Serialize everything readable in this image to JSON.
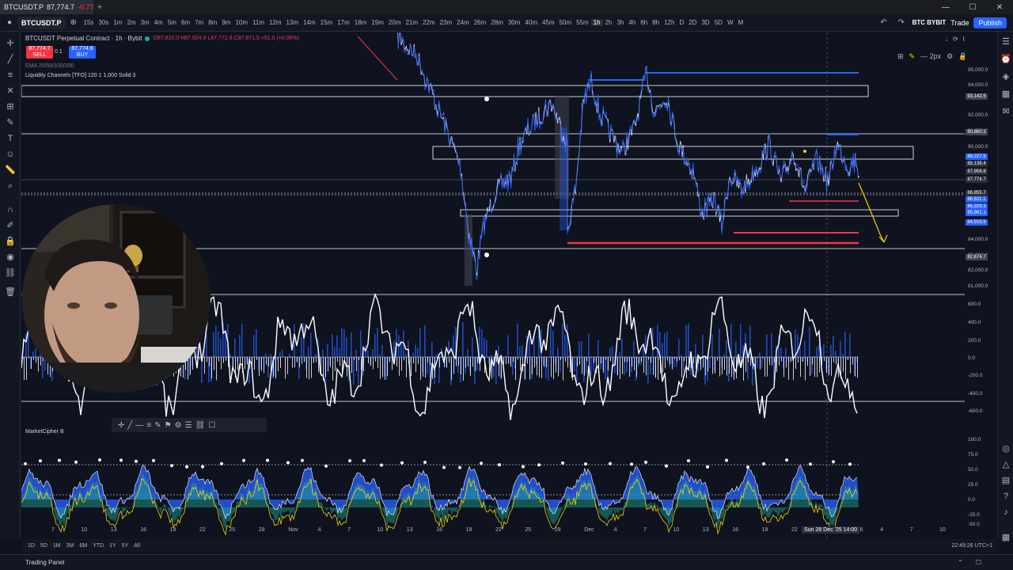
{
  "browser": {
    "tab_symbol": "BTCUSDT.P",
    "tab_price": "87,774.7",
    "tab_change": "-0.77%",
    "new_tab": "+",
    "controls": [
      "—",
      "☐",
      "✕"
    ]
  },
  "toolbar": {
    "symbol": "BTCUSDT.P",
    "timeframes": [
      "15s",
      "30s",
      "1m",
      "2m",
      "3m",
      "4m",
      "5m",
      "6m",
      "7m",
      "8m",
      "9m",
      "10m",
      "11m",
      "12m",
      "13m",
      "14m",
      "15m",
      "17m",
      "18m",
      "19m",
      "20m",
      "21m",
      "22m",
      "23m",
      "24m",
      "26m",
      "28m",
      "30m",
      "40m",
      "45m",
      "50m",
      "55m",
      "1h",
      "2h",
      "3h",
      "4h",
      "6h",
      "8h",
      "12h",
      "D",
      "2D",
      "3D",
      "5D",
      "W",
      "M"
    ],
    "active_timeframe": "1h",
    "exchange": "BTC BYBIT",
    "trade_label": "Trade",
    "publish_label": "Publish"
  },
  "legend": {
    "title": "BTCUSDT Perpetual Contract · 1h · Bybit",
    "ohlc": "O87,820.0 H87,924.9 L87,772.8 C87,871.5 +51.0 (+0.06%)",
    "sell_price": "87,774.7",
    "sell_label": "SELL",
    "qty": "0.1",
    "buy_price": "87,774.8",
    "buy_label": "BUY",
    "ema_line": "EMA 20/50/100/200",
    "liquidity_line": "Liquidity Channels [TFO] 120 1 1,000 Solid 3",
    "market_cipher": "MarketCipher B"
  },
  "price_axis": {
    "labels": [
      "95,000.0",
      "94,000.0",
      "92,000.0",
      "91,000.0",
      "90,000.0",
      "84,000.0",
      "83,000.0",
      "82,000.0",
      "81,000.0"
    ],
    "tags": [
      {
        "text": "93,142.5",
        "color": "#434651"
      },
      {
        "text": "90,860.3",
        "color": "#434651"
      },
      {
        "text": "89,227.5",
        "color": "#2962ff"
      },
      {
        "text": "88,138.4",
        "color": "#2a2e39"
      },
      {
        "text": "87,958.8",
        "color": "#2a2e39"
      },
      {
        "text": "87,774.7",
        "color": "#2a2e39"
      },
      {
        "text": "86,855.7",
        "color": "#2a2e39"
      },
      {
        "text": "86,611.1",
        "color": "#2962ff"
      },
      {
        "text": "86,329.3",
        "color": "#2962ff"
      },
      {
        "text": "85,961.1",
        "color": "#2962ff"
      },
      {
        "text": "84,915.9",
        "color": "#2962ff"
      },
      {
        "text": "82,674.7",
        "color": "#434651"
      }
    ],
    "osc_labels": [
      "600.0",
      "400.0",
      "200.0",
      "0.0",
      "-200.0",
      "-400.0",
      "-600.0"
    ],
    "mcb_labels": [
      "100.0",
      "75.0",
      "50.0",
      "25.0",
      "0.0",
      "-25.0",
      "-50.0"
    ]
  },
  "time_axis": {
    "labels": [
      "7",
      "10",
      "13",
      "16",
      "19",
      "22",
      "25",
      "28",
      "Nov",
      "4",
      "7",
      "10",
      "13",
      "16",
      "19",
      "22",
      "25",
      "28",
      "Dec",
      "4",
      "7",
      "10",
      "13",
      "16",
      "19",
      "22",
      "25",
      "2026",
      "4",
      "7",
      "10"
    ],
    "current": "Sun 28 Dec '25  14:00"
  },
  "bottom_bar": {
    "ranges": [
      "1D",
      "5D",
      "1M",
      "3M",
      "6M",
      "YTD",
      "1Y",
      "5Y",
      "All"
    ],
    "clock": "22:49:26 UTC+1"
  },
  "panel": {
    "label": "Trading Panel"
  },
  "drawing_toolbar": {
    "icons": [
      "crosshair-icon",
      "trendline-icon",
      "horizontal-line-icon",
      "menu-icon",
      "brush-icon",
      "flag-icon",
      "settings-icon",
      "list-icon",
      "link-icon",
      "square-icon"
    ]
  },
  "colors": {
    "background": "#0f1320",
    "accent_blue": "#2962ff",
    "red": "#f23645",
    "yellow": "#f5d300",
    "white_line": "#ffffff"
  }
}
